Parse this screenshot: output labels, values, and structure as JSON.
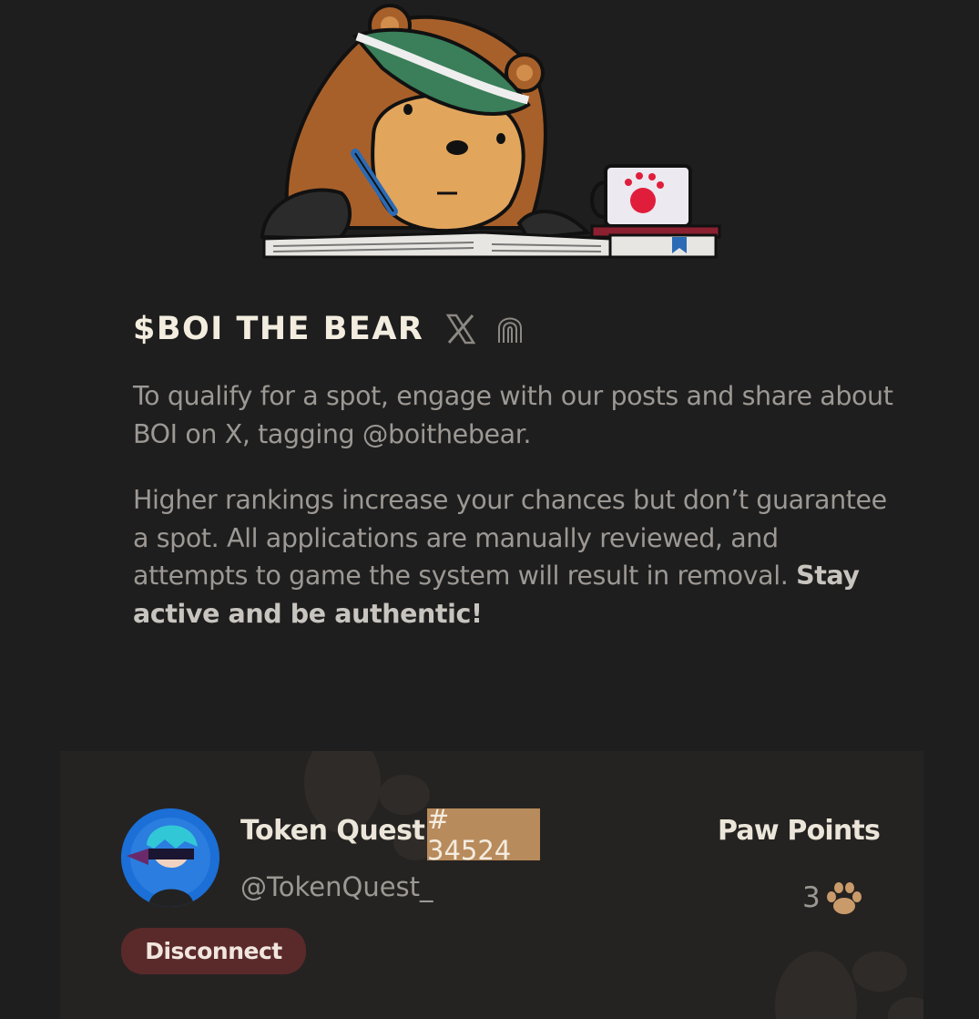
{
  "hero": {
    "image": "bear-writing-illustration"
  },
  "header": {
    "title": "$BOI THE BEAR",
    "icons": [
      "x-logo-icon",
      "fingerprint-icon"
    ]
  },
  "intro": {
    "paragraph1": "To qualify for a spot, engage with our posts and share about BOI on X, tagging @boithebear.",
    "paragraph2": "Higher rankings increase your chances but don’t guarantee a spot. All applications are manually reviewed, and attempts to game the system will result in removal.",
    "paragraph2_emphasis": "Stay active and be authentic!"
  },
  "profile": {
    "name": "Token Quest",
    "rank": "# 34524",
    "handle": "@TokenQuest_",
    "disconnect_label": "Disconnect",
    "points_label": "Paw Points",
    "points_value": "3"
  },
  "colors": {
    "background": "#1f1e1e",
    "card": "#252321",
    "rank_badge": "#b88b5c",
    "disconnect": "#5a2a2a",
    "paw": "#c99b6a"
  }
}
